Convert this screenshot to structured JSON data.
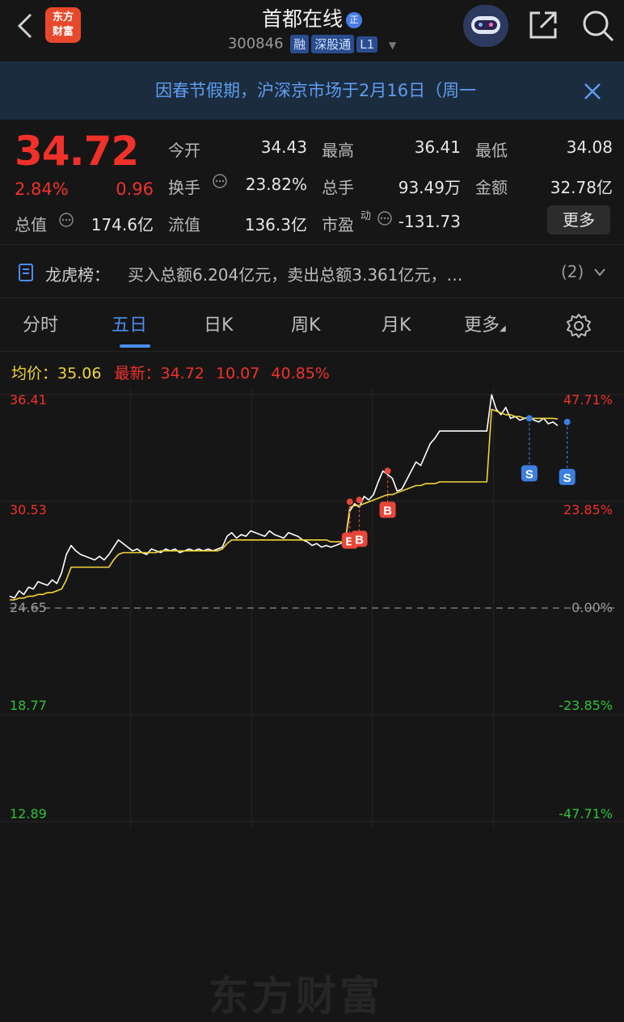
{
  "header": {
    "app_logo_line1": "东方",
    "app_logo_line2": "财富",
    "stock_name": "首都在线",
    "badge": "正",
    "code": "300846",
    "tag_margin": "融",
    "tag_connect": "深股通",
    "tag_level": "L1"
  },
  "notice": {
    "text": "因春节假期，沪深京市场于2月16日（周一"
  },
  "quote": {
    "price": "34.72",
    "change_pct": "2.84%",
    "change_amt": "0.96",
    "market_cap_label": "总值",
    "market_cap": "174.6亿",
    "open_label": "今开",
    "open": "34.43",
    "high_label": "最高",
    "high": "36.41",
    "low_label": "最低",
    "low": "34.08",
    "turnover_label": "换手",
    "turnover": "23.82%",
    "volume_label": "总手",
    "volume": "93.49万",
    "amount_label": "金额",
    "amount": "32.78亿",
    "float_cap_label": "流值",
    "float_cap": "136.3亿",
    "pe_label": "市盈",
    "pe_sup": "动",
    "pe": "-131.73",
    "more_button": "更多"
  },
  "dragon": {
    "label": "龙虎榜：",
    "text": "买入总额6.204亿元，卖出总额3.361亿元，…",
    "count": "(2)"
  },
  "tabs": [
    {
      "label": "分时"
    },
    {
      "label": "五日"
    },
    {
      "label": "日K"
    },
    {
      "label": "周K"
    },
    {
      "label": "月K"
    },
    {
      "label": "更多"
    }
  ],
  "chart_info": {
    "avg_label": "均价：",
    "avg": "35.06",
    "latest_label": "最新：",
    "latest": "34.72",
    "v1": "10.07",
    "v2": "40.85%"
  },
  "chart_data": {
    "type": "line",
    "title": "",
    "y_left_ticks": [
      "36.41",
      "30.53",
      "24.65",
      "18.77",
      "12.89"
    ],
    "y_right_ticks": [
      "47.71%",
      "23.85%",
      "0.00%",
      "-23.85%",
      "-47.71%"
    ],
    "ylim": [
      12.89,
      36.41
    ],
    "prev_close": 24.65,
    "days": 5,
    "series": [
      {
        "color": "#ffffff",
        "values": [
          25.3,
          25.2,
          25.6,
          25.4,
          25.8,
          25.7,
          26.1,
          26.0,
          25.9,
          26.2,
          26.0,
          26.6,
          27.6,
          28.1,
          27.8,
          27.6,
          27.5,
          27.4,
          27.3,
          27.5,
          27.3,
          27.6,
          28.0,
          28.4,
          28.2,
          28.0,
          27.8,
          27.9,
          27.7,
          27.6,
          27.9,
          27.8,
          27.7,
          27.9,
          27.8,
          27.9,
          27.7,
          27.8,
          27.9,
          27.8,
          27.9,
          27.8,
          27.9,
          27.8,
          27.9,
          28.0,
          28.6,
          28.8,
          28.5,
          28.7,
          28.6,
          28.9,
          28.8,
          28.7,
          28.6,
          28.9,
          28.7,
          28.6,
          28.5,
          28.8,
          28.7,
          28.6,
          28.4,
          28.3,
          28.1,
          28.2,
          28.0,
          28.1,
          28.0,
          28.1,
          28.2,
          28.3,
          30.0,
          30.4,
          30.2,
          30.8,
          30.6,
          30.9,
          31.6,
          32.2,
          32.0,
          31.8,
          31.1,
          31.2,
          31.7,
          32.2,
          32.7,
          32.5,
          33.1,
          33.7,
          34.0,
          34.4,
          34.4,
          34.4,
          34.4,
          34.4,
          34.4,
          34.4,
          34.4,
          34.4,
          34.4,
          34.4,
          36.4,
          35.6,
          35.3,
          35.7,
          35.1,
          35.2,
          35.0,
          35.1,
          35.2,
          35.0,
          34.9,
          35.1,
          34.8,
          34.9,
          34.7
        ]
      },
      {
        "color": "#f0d43a",
        "values": [
          25.1,
          25.1,
          25.2,
          25.2,
          25.3,
          25.3,
          25.4,
          25.4,
          25.5,
          25.5,
          25.6,
          25.7,
          26.2,
          26.9,
          26.9,
          26.9,
          26.9,
          26.9,
          26.9,
          26.9,
          26.9,
          26.9,
          27.3,
          27.6,
          27.7,
          27.7,
          27.7,
          27.7,
          27.7,
          27.7,
          27.7,
          27.7,
          27.8,
          27.8,
          27.8,
          27.8,
          27.8,
          27.8,
          27.8,
          27.8,
          27.8,
          27.8,
          27.8,
          27.8,
          27.8,
          27.9,
          28.2,
          28.4,
          28.4,
          28.4,
          28.4,
          28.4,
          28.4,
          28.4,
          28.4,
          28.4,
          28.4,
          28.4,
          28.4,
          28.4,
          28.4,
          28.4,
          28.4,
          28.4,
          28.4,
          28.4,
          28.4,
          28.4,
          28.3,
          28.3,
          28.3,
          28.3,
          30.2,
          30.3,
          30.3,
          30.4,
          30.5,
          30.6,
          30.7,
          30.8,
          30.9,
          30.9,
          31.0,
          31.1,
          31.2,
          31.3,
          31.4,
          31.4,
          31.5,
          31.5,
          31.5,
          31.6,
          31.6,
          31.6,
          31.6,
          31.6,
          31.6,
          31.6,
          31.6,
          31.6,
          31.6,
          31.6,
          35.6,
          35.5,
          35.4,
          35.3,
          35.3,
          35.2,
          35.2,
          35.1,
          35.1,
          35.1,
          35.1,
          35.1,
          35.1,
          35.1,
          35.06
        ]
      }
    ],
    "markers": [
      {
        "label": "B",
        "index": 72,
        "value": 30.5
      },
      {
        "label": "B",
        "index": 74,
        "value": 30.6
      },
      {
        "label": "B",
        "index": 80,
        "value": 32.2
      },
      {
        "label": "S",
        "index": 110,
        "value": 35.1
      },
      {
        "label": "S",
        "index": 118,
        "value": 34.9
      }
    ],
    "watermark": "东方财富"
  }
}
